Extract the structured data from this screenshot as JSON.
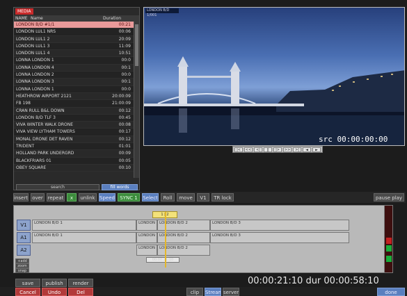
{
  "bin": {
    "tab": "MEDIA",
    "columns": [
      "NAME",
      "Name",
      "Duration"
    ],
    "rows": [
      {
        "name": "LONDON B/D #1/1",
        "dur": "00:21"
      },
      {
        "name": "LONDON LUL1 NRS",
        "dur": "00:06"
      },
      {
        "name": "LONDON LUL1 2",
        "dur": "20:09"
      },
      {
        "name": "LONDON LUL1 3",
        "dur": "11:09"
      },
      {
        "name": "LONDON LUL1 4",
        "dur": "10:51"
      },
      {
        "name": "LONNA LONDON 1",
        "dur": "00:0"
      },
      {
        "name": "LONNA LONDON 4",
        "dur": "00:1"
      },
      {
        "name": "LONNA LONDON 2",
        "dur": "00:0"
      },
      {
        "name": "LONNA LONDON 3",
        "dur": "00:1"
      },
      {
        "name": "LONNA LONDON 1",
        "dur": "00:0"
      },
      {
        "name": "HEATHROW AIRPORT 2121",
        "dur": "20:00:09"
      },
      {
        "name": "FB 198",
        "dur": "21:00:09"
      },
      {
        "name": "CRAN RULL B&L DOWN",
        "dur": "00:12"
      },
      {
        "name": "LONDON B/D TLF 3",
        "dur": "00:45"
      },
      {
        "name": "VIVA WINTER WALK DRONE",
        "dur": "00:08"
      },
      {
        "name": "VIVA VIEW LYTHAM TOWERS",
        "dur": "00:17"
      },
      {
        "name": "MONAL DRONE DET RAVEN",
        "dur": "00:12"
      },
      {
        "name": "TRIDENT",
        "dur": "01:01"
      },
      {
        "name": "HOLLAND PARK UNDERGRD",
        "dur": "00:09"
      },
      {
        "name": "BLACKFRIARS 01",
        "dur": "00:05"
      },
      {
        "name": "OBEY SQUARE",
        "dur": "00:10"
      }
    ],
    "search_label": "search",
    "filter_label": "fill words"
  },
  "viewer": {
    "title": "LONDON B/D 1/001",
    "src_timecode": "src 00:00:00:00"
  },
  "transport": [
    "|<",
    "<<",
    "<|",
    "||",
    "|>",
    ">>",
    ">|",
    "◄",
    "►"
  ],
  "toolbar": {
    "items": [
      {
        "label": "insert",
        "style": "normal"
      },
      {
        "label": "over",
        "style": "normal"
      },
      {
        "label": "repeat",
        "style": "normal"
      },
      {
        "label": "x",
        "style": "green"
      },
      {
        "label": "unlink",
        "style": "normal"
      },
      {
        "label": "Speed",
        "style": "blue"
      },
      {
        "label": "SYNC 1",
        "style": "green"
      },
      {
        "label": "Select",
        "style": "blue"
      },
      {
        "label": "Roll",
        "style": "normal"
      },
      {
        "label": "move",
        "style": "normal"
      },
      {
        "label": "V1",
        "style": "normal"
      },
      {
        "label": "TR lock",
        "style": "normal"
      },
      {
        "label": "pause play",
        "style": "normal"
      }
    ]
  },
  "timeline": {
    "marks": "1 | 2",
    "tracks": [
      {
        "label": "V1",
        "clips": [
          "LONDON B/D 1",
          "LONDON B",
          "LONDON B/D 2",
          "LONDON B/D 3"
        ]
      },
      {
        "label": "A1",
        "clips": [
          "LONDON B/D 1",
          "LONDON B",
          "LONDON B/D 2",
          "LONDON B/D 3"
        ]
      },
      {
        "label": "A2",
        "clips": [
          "LONDON B",
          "LONDON B/D 2"
        ]
      }
    ],
    "sub_labels": [
      "+add",
      "zoom",
      "snap"
    ],
    "playhead_tc": "00:00:21:10"
  },
  "bottom": {
    "buttons_top": [
      "save",
      "publish",
      "render"
    ],
    "buttons_bottom": [
      "Cancel",
      "Undo",
      "Del"
    ],
    "mode_buttons": [
      "clip",
      "Stream",
      "server"
    ],
    "timecode_line": "00:00:21:10 dur 00:00:58:10",
    "right_button": "done"
  }
}
